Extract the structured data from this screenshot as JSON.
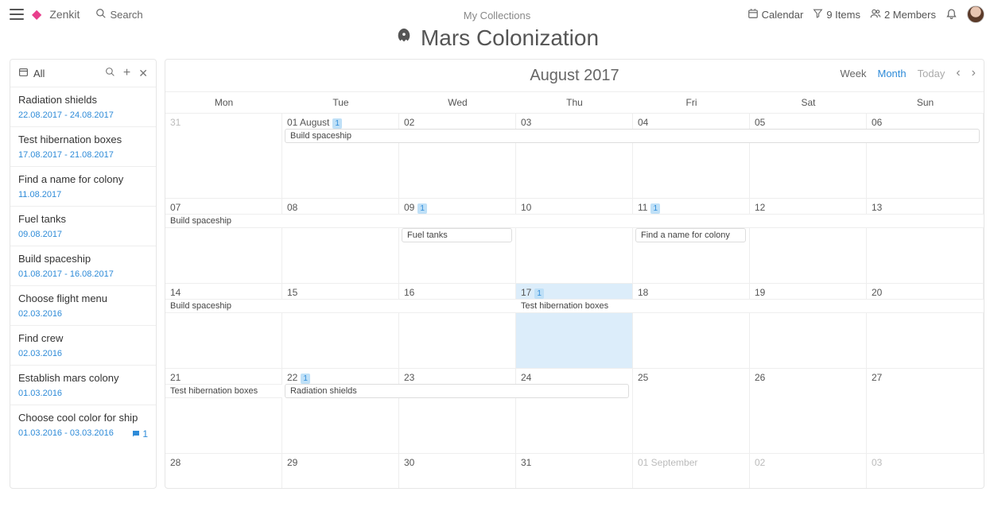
{
  "header": {
    "brand": "Zenkit",
    "search_label": "Search",
    "breadcrumb": "My Collections",
    "title": "Mars Colonization",
    "calendar_label": "Calendar",
    "items_label": "9 Items",
    "members_label": "2 Members"
  },
  "sidebar": {
    "all_label": "All",
    "items": [
      {
        "title": "Radiation shields",
        "date": "22.08.2017 - 24.08.2017"
      },
      {
        "title": "Test hibernation boxes",
        "date": "17.08.2017 - 21.08.2017"
      },
      {
        "title": "Find a name for colony",
        "date": "11.08.2017"
      },
      {
        "title": "Fuel tanks",
        "date": "09.08.2017"
      },
      {
        "title": "Build spaceship",
        "date": "01.08.2017 - 16.08.2017"
      },
      {
        "title": "Choose flight menu",
        "date": "02.03.2016"
      },
      {
        "title": "Find crew",
        "date": "02.03.2016"
      },
      {
        "title": "Establish mars colony",
        "date": "01.03.2016"
      },
      {
        "title": "Choose cool color for ship",
        "date": "01.03.2016 - 03.03.2016",
        "comments": "1"
      }
    ]
  },
  "calendar": {
    "title": "August 2017",
    "view_week": "Week",
    "view_month": "Month",
    "today": "Today",
    "days": [
      "Mon",
      "Tue",
      "Wed",
      "Thu",
      "Fri",
      "Sat",
      "Sun"
    ],
    "weeks": [
      [
        {
          "d": "31",
          "dim": true
        },
        {
          "d": "01 August",
          "badge": "1"
        },
        {
          "d": "02"
        },
        {
          "d": "03"
        },
        {
          "d": "04"
        },
        {
          "d": "05"
        },
        {
          "d": "06"
        }
      ],
      [
        {
          "d": "07"
        },
        {
          "d": "08"
        },
        {
          "d": "09",
          "badge": "1"
        },
        {
          "d": "10"
        },
        {
          "d": "11",
          "badge": "1"
        },
        {
          "d": "12"
        },
        {
          "d": "13"
        }
      ],
      [
        {
          "d": "14"
        },
        {
          "d": "15"
        },
        {
          "d": "16"
        },
        {
          "d": "17",
          "badge": "1",
          "today": true
        },
        {
          "d": "18"
        },
        {
          "d": "19"
        },
        {
          "d": "20"
        }
      ],
      [
        {
          "d": "21"
        },
        {
          "d": "22",
          "badge": "1"
        },
        {
          "d": "23"
        },
        {
          "d": "24"
        },
        {
          "d": "25"
        },
        {
          "d": "26"
        },
        {
          "d": "27"
        }
      ],
      [
        {
          "d": "28"
        },
        {
          "d": "29"
        },
        {
          "d": "30"
        },
        {
          "d": "31"
        },
        {
          "d": "01 September",
          "dim": true
        },
        {
          "d": "02",
          "dim": true
        },
        {
          "d": "03",
          "dim": true
        }
      ]
    ],
    "events": {
      "build_spaceship_0": "Build spaceship",
      "build_spaceship_1": "Build spaceship",
      "build_spaceship_2": "Build spaceship",
      "fuel_tanks": "Fuel tanks",
      "find_name": "Find a name for colony",
      "test_hiber_0": "Test hibernation boxes",
      "test_hiber_1": "Test hibernation boxes",
      "radiation": "Radiation shields"
    }
  }
}
